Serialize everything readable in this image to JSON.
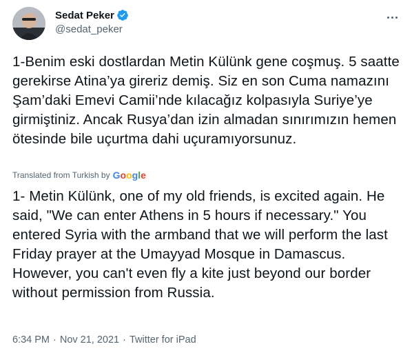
{
  "author": {
    "name": "Sedat Peker",
    "handle": "@sedat_peker",
    "verified": true,
    "avatar_icon": "user-avatar"
  },
  "tweet": {
    "original_text": "1-Benim eski dostlardan Metin Külünk gene coşmuş. 5 saatte gerekirse Atina’ya gireriz demiş. Siz en son Cuma namazını Şam’daki Emevi Camii’nde kılacağız kolpasıyla Suriye’ye girmiştiniz. Ancak Rusya’dan izin almadan sınırımızın hemen ötesinde bile uçurtma dahi uçuramıyorsunuz.",
    "translated_label": "Translated from Turkish by",
    "translation_provider": "Google",
    "translated_text": "1- Metin Külünk, one of my old friends, is excited again. He said, \"We can enter Athens in 5 hours if necessary.\" You entered Syria with the armband that we will perform the last Friday prayer at the Umayyad Mosque in Damascus. However, you can't even fly a kite just beyond our border without permission from Russia."
  },
  "meta": {
    "time": "6:34 PM",
    "separator": "·",
    "date": "Nov 21, 2021",
    "source": "Twitter for iPad"
  },
  "colors": {
    "verified_badge": "#1d9bf0",
    "text_primary": "#0f1419",
    "text_secondary": "#536471",
    "google_blue": "#4285f4",
    "google_red": "#ea4335",
    "google_yellow": "#fbbc05",
    "google_green": "#34a853"
  }
}
